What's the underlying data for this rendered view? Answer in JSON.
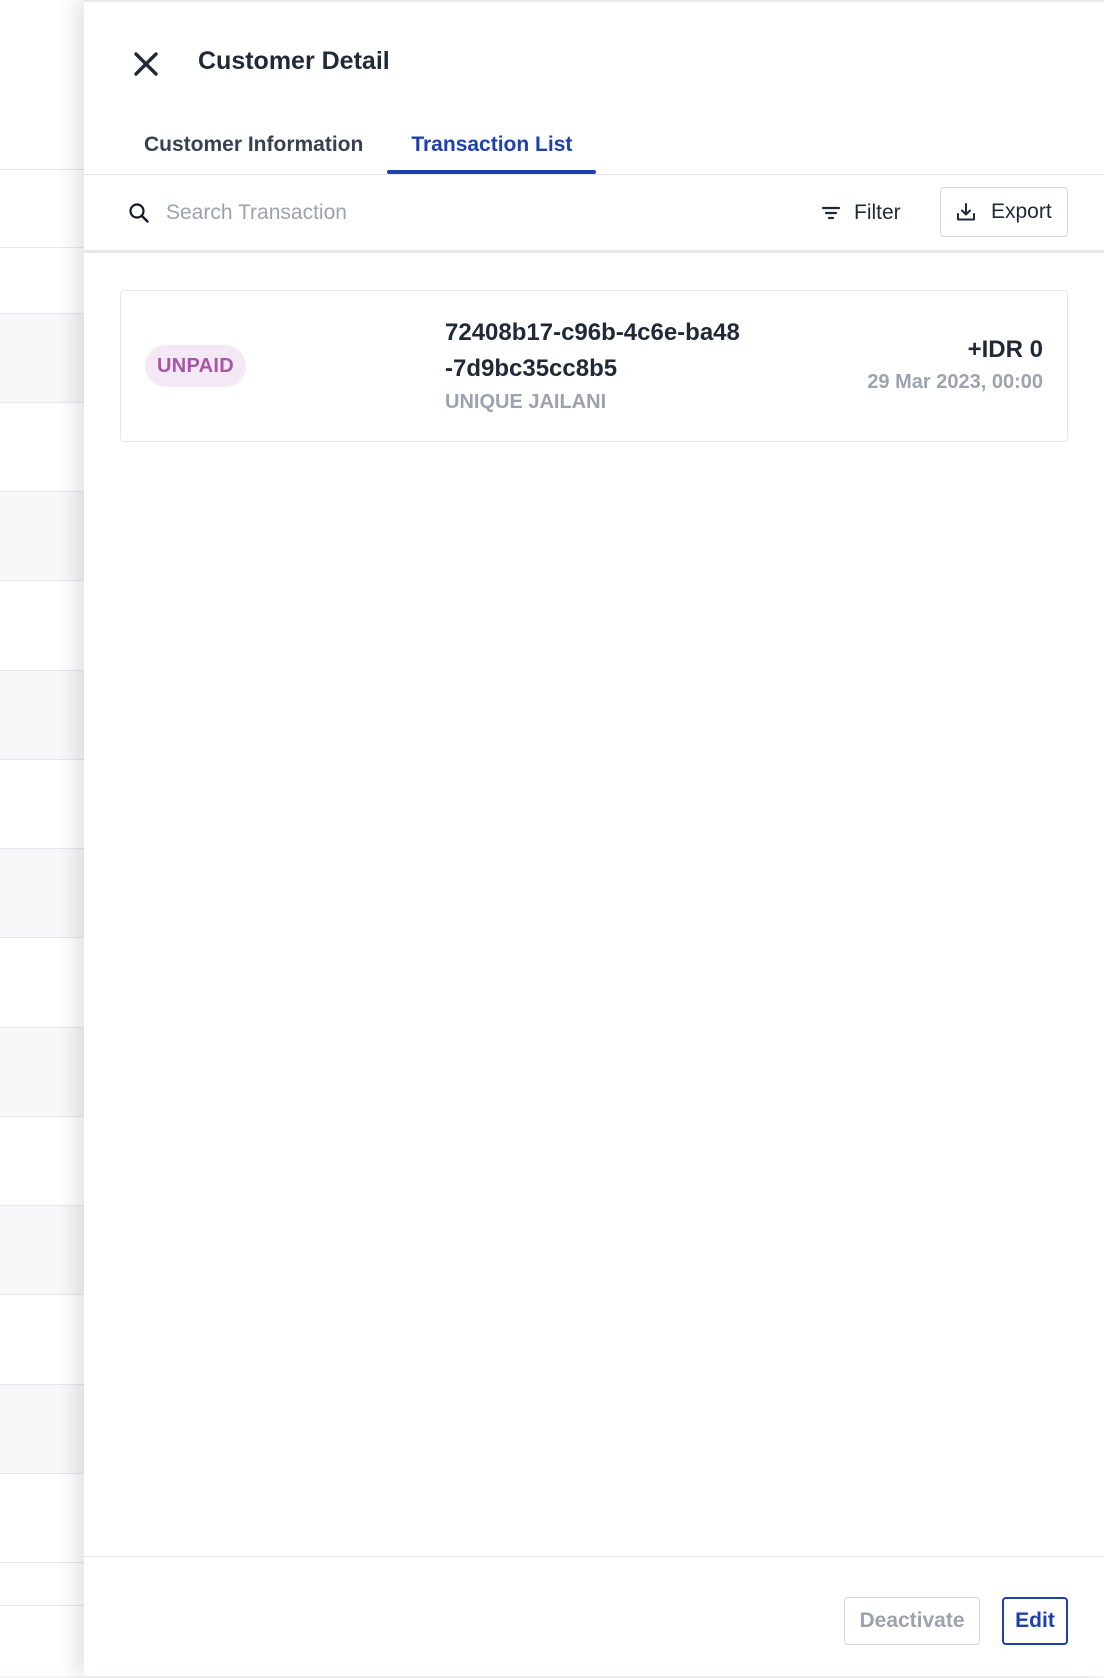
{
  "drawer": {
    "title": "Customer Detail"
  },
  "tabs": [
    {
      "label": "Customer Information",
      "active": false
    },
    {
      "label": "Transaction List",
      "active": true
    }
  ],
  "toolbar": {
    "search_placeholder": "Search Transaction",
    "search_value": "",
    "filter_label": "Filter",
    "export_label": "Export"
  },
  "transactions": [
    {
      "status": "UNPAID",
      "id": "72408b17-c96b-4c6e-ba48-7d9bc35cc8b5",
      "customer": "UNIQUE JAILANI",
      "amount": "+IDR 0",
      "date": "29 Mar 2023, 00:00"
    }
  ],
  "footer": {
    "deactivate_label": "Deactivate",
    "edit_label": "Edit"
  },
  "colors": {
    "accent": "#1e40af",
    "unpaid_text": "#a855a8",
    "unpaid_bg": "#f3e8f4",
    "muted": "#9ca3af"
  },
  "icons": {
    "close": "close-icon",
    "search": "search-icon",
    "filter": "filter-icon",
    "export": "download-icon"
  }
}
